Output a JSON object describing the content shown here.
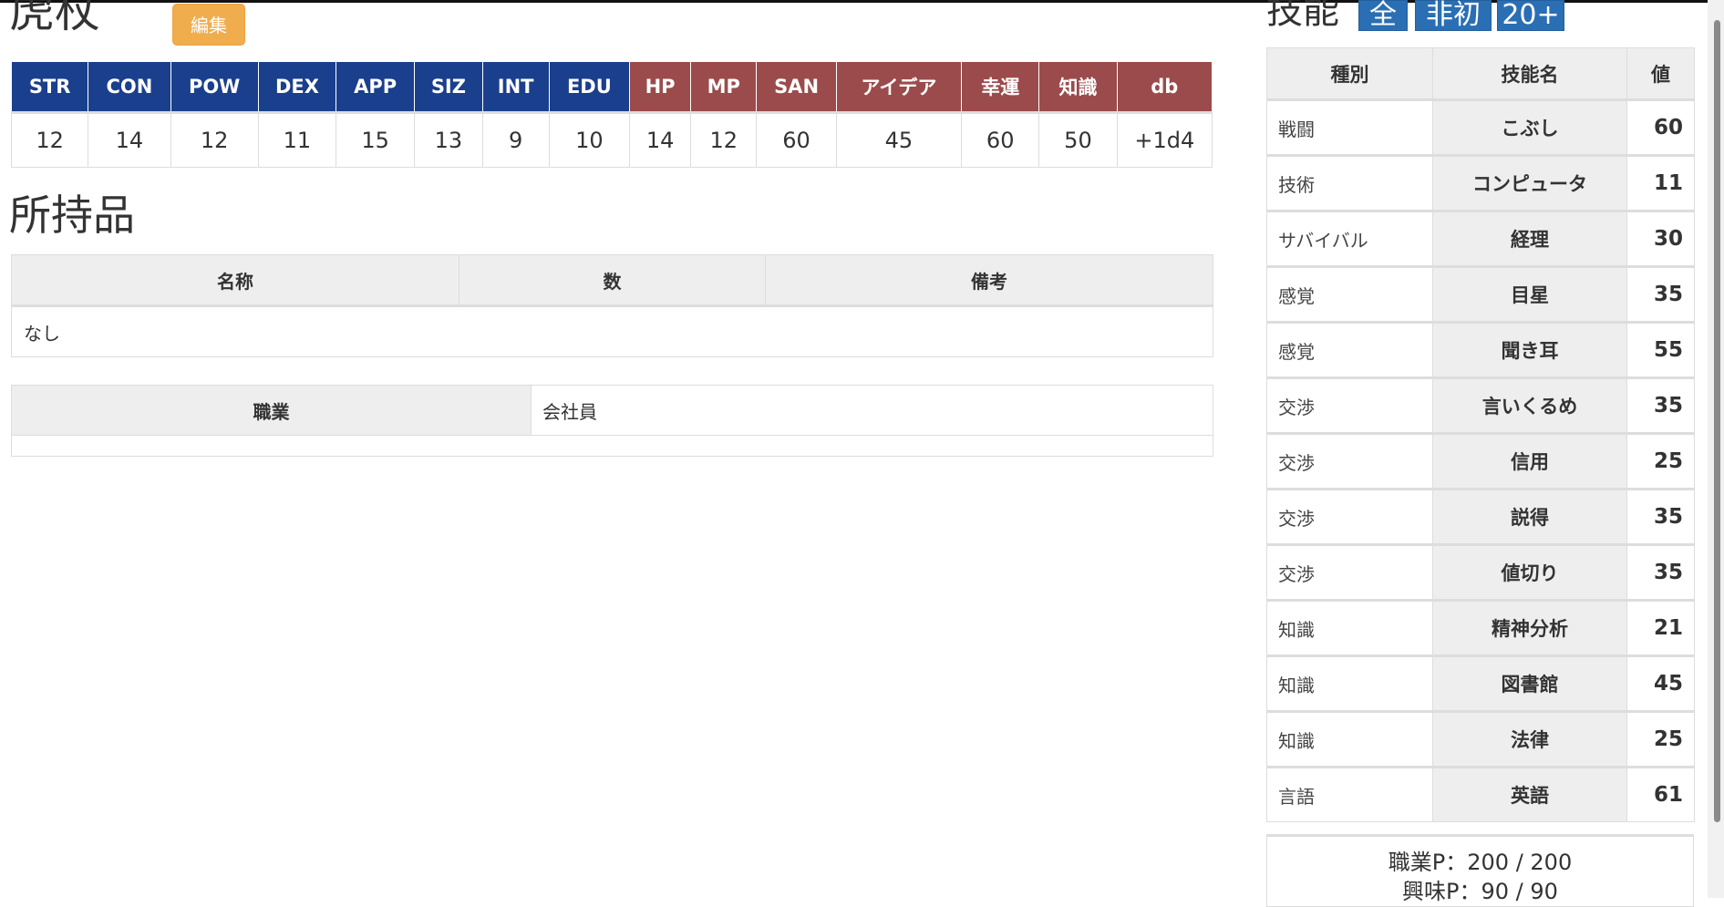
{
  "character": {
    "name": "虎杖",
    "edit_label": "編集"
  },
  "stats": {
    "headers": [
      "STR",
      "CON",
      "POW",
      "DEX",
      "APP",
      "SIZ",
      "INT",
      "EDU",
      "HP",
      "MP",
      "SAN",
      "アイデア",
      "幸運",
      "知識",
      "db"
    ],
    "values": [
      "12",
      "14",
      "12",
      "11",
      "15",
      "13",
      "9",
      "10",
      "14",
      "12",
      "60",
      "45",
      "60",
      "50",
      "+1d4"
    ]
  },
  "inventory": {
    "title": "所持品",
    "headers": [
      "名称",
      "数",
      "備考"
    ],
    "empty_text": "なし"
  },
  "job": {
    "label": "職業",
    "value": "会社員"
  },
  "skills": {
    "title": "技能",
    "filter_buttons": [
      "全",
      "非初",
      "20+"
    ],
    "headers": [
      "種別",
      "技能名",
      "値"
    ],
    "rows": [
      {
        "category": "戦闘",
        "name": "こぶし",
        "value": "60"
      },
      {
        "category": "技術",
        "name": "コンピュータ",
        "value": "11"
      },
      {
        "category": "サバイバル",
        "name": "経理",
        "value": "30"
      },
      {
        "category": "感覚",
        "name": "目星",
        "value": "35"
      },
      {
        "category": "感覚",
        "name": "聞き耳",
        "value": "55"
      },
      {
        "category": "交渉",
        "name": "言いくるめ",
        "value": "35"
      },
      {
        "category": "交渉",
        "name": "信用",
        "value": "25"
      },
      {
        "category": "交渉",
        "name": "説得",
        "value": "35"
      },
      {
        "category": "交渉",
        "name": "値切り",
        "value": "35"
      },
      {
        "category": "知識",
        "name": "精神分析",
        "value": "21"
      },
      {
        "category": "知識",
        "name": "図書館",
        "value": "45"
      },
      {
        "category": "知識",
        "name": "法律",
        "value": "25"
      },
      {
        "category": "言語",
        "name": "英語",
        "value": "61"
      }
    ],
    "occupation_points": "職業P：200 / 200",
    "interest_points": "興味P：90 / 90"
  }
}
